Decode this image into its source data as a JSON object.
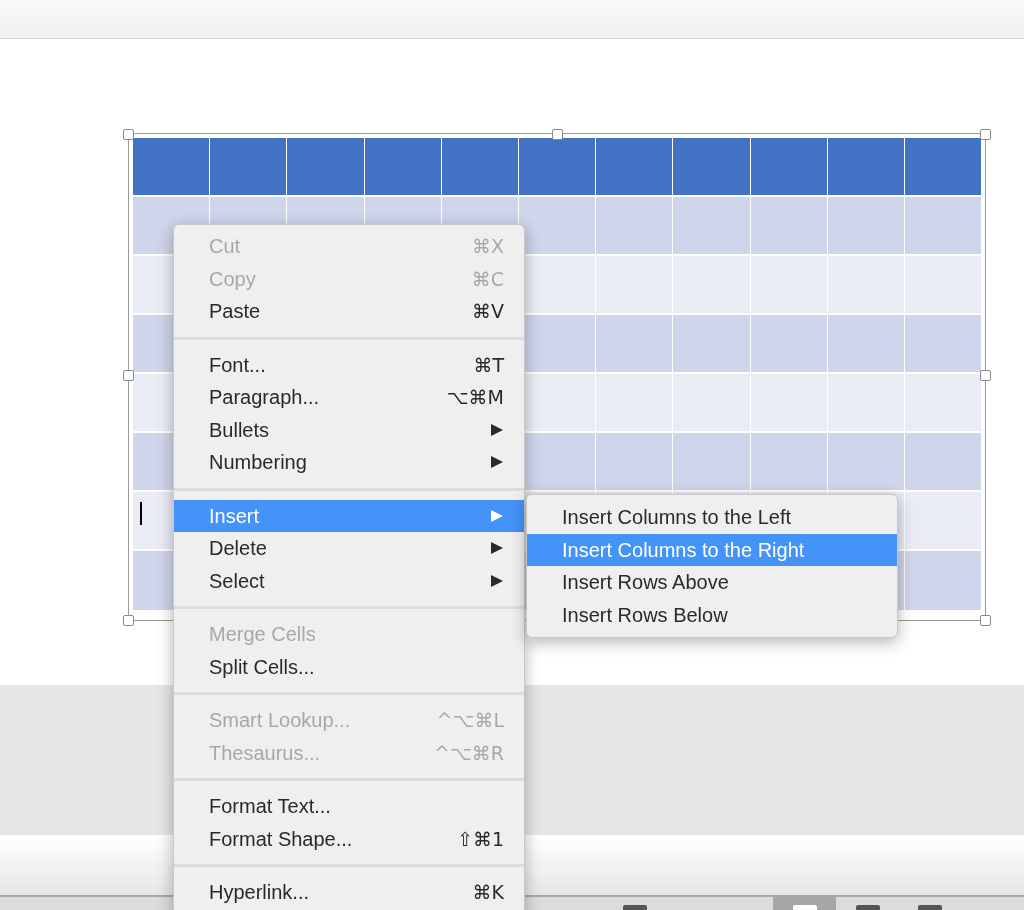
{
  "context_menu": {
    "sections": [
      [
        {
          "label": "Cut",
          "shortcut": "⌘X",
          "submenu": false,
          "disabled": true,
          "selected": false
        },
        {
          "label": "Copy",
          "shortcut": "⌘C",
          "submenu": false,
          "disabled": true,
          "selected": false
        },
        {
          "label": "Paste",
          "shortcut": "⌘V",
          "submenu": false,
          "disabled": false,
          "selected": false
        }
      ],
      [
        {
          "label": "Font...",
          "shortcut": "⌘T",
          "submenu": false,
          "disabled": false,
          "selected": false
        },
        {
          "label": "Paragraph...",
          "shortcut": "⌥⌘M",
          "submenu": false,
          "disabled": false,
          "selected": false
        },
        {
          "label": "Bullets",
          "submenu": true,
          "disabled": false,
          "selected": false
        },
        {
          "label": "Numbering",
          "submenu": true,
          "disabled": false,
          "selected": false
        }
      ],
      [
        {
          "label": "Insert",
          "submenu": true,
          "disabled": false,
          "selected": true
        },
        {
          "label": "Delete",
          "submenu": true,
          "disabled": false,
          "selected": false
        },
        {
          "label": "Select",
          "submenu": true,
          "disabled": false,
          "selected": false
        }
      ],
      [
        {
          "label": "Merge Cells",
          "submenu": false,
          "disabled": true,
          "selected": false
        },
        {
          "label": "Split Cells...",
          "submenu": false,
          "disabled": false,
          "selected": false
        }
      ],
      [
        {
          "label": "Smart Lookup...",
          "shortcut": "^⌥⌘L",
          "submenu": false,
          "disabled": true,
          "selected": false
        },
        {
          "label": "Thesaurus...",
          "shortcut": "^⌥⌘R",
          "submenu": false,
          "disabled": true,
          "selected": false
        }
      ],
      [
        {
          "label": "Format Text...",
          "submenu": false,
          "disabled": false,
          "selected": false
        },
        {
          "label": "Format Shape...",
          "shortcut": "⇧⌘1",
          "submenu": false,
          "disabled": false,
          "selected": false
        }
      ],
      [
        {
          "label": "Hyperlink...",
          "shortcut": "⌘K",
          "submenu": false,
          "disabled": false,
          "selected": false
        }
      ]
    ]
  },
  "submenu": {
    "items": [
      {
        "label": "Insert Columns to the Left",
        "selected": false
      },
      {
        "label": "Insert Columns to the Right",
        "selected": true
      },
      {
        "label": "Insert Rows Above",
        "selected": false
      },
      {
        "label": "Insert Rows Below",
        "selected": false
      }
    ]
  },
  "view_buttons": [
    {
      "selected": false
    },
    {
      "selected": true
    },
    {
      "selected": false
    },
    {
      "selected": false
    }
  ]
}
